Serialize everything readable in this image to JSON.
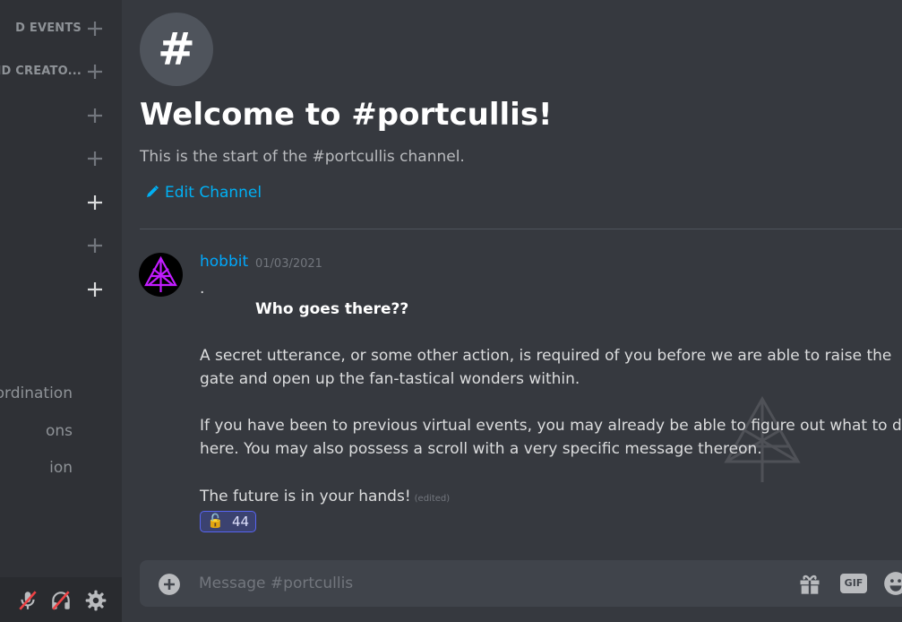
{
  "sidebar": {
    "categories": [
      {
        "label": "D EVENTS"
      },
      {
        "label": "AND CREATO..."
      },
      {
        "label": ""
      },
      {
        "label": ""
      },
      {
        "label": ""
      },
      {
        "label": ""
      },
      {
        "label": ""
      }
    ],
    "channels": [
      {
        "label": "ordination"
      },
      {
        "label": "ons"
      },
      {
        "label": "ion"
      }
    ],
    "user_panel": {
      "icons": [
        "microphone-muted-icon",
        "headphones-deafened-icon",
        "settings-gear-icon"
      ]
    }
  },
  "channel": {
    "badge_glyph": "#",
    "welcome_title": "Welcome to #portcullis!",
    "welcome_subtitle": "This is the start of the #portcullis channel.",
    "edit_label": "Edit Channel"
  },
  "message": {
    "author": "hobbit",
    "timestamp": "01/03/2021",
    "lines": {
      "dot": ".",
      "bold": "Who goes there??",
      "p1_line1": "A secret utterance, or some other action, is required of you before we are able to raise the",
      "p1_line2": "gate and open up the fan-tastical wonders within.",
      "p2_line1": "If you have been to previous virtual events, you may already be able to figure out what to do",
      "p2_line2": "here.  You may also possess a scroll with a very specific message thereon.",
      "p3": "The future is in your hands!"
    },
    "edited_label": "(edited)",
    "reaction": {
      "emoji": "🔓",
      "count": "44"
    }
  },
  "composer": {
    "placeholder": "Message #portcullis",
    "gif_label": "GIF"
  },
  "colors": {
    "background": "#36393f",
    "sidebar": "#2f3136",
    "link": "#00b0f4",
    "author": "#00a8fc",
    "accent": "#5865f2",
    "avatar_icon": "#c21cff"
  }
}
